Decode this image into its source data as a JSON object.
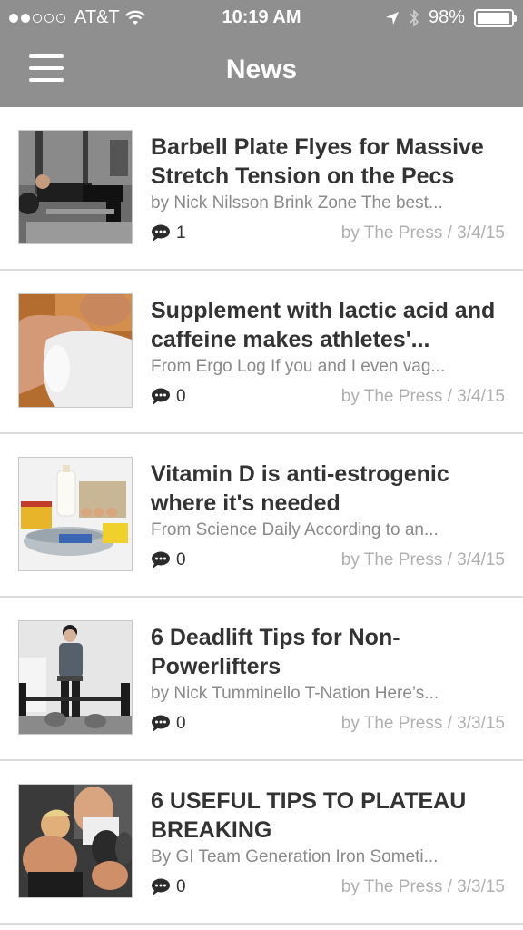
{
  "status_bar": {
    "carrier": "AT&T",
    "time": "10:19 AM",
    "battery": "98%",
    "battery_level": 0.98,
    "icons": [
      "signal-dots-icon",
      "wifi-icon",
      "location-arrow-icon",
      "bluetooth-icon",
      "battery-icon"
    ]
  },
  "navbar": {
    "title": "News",
    "menu_icon": "hamburger-menu-icon",
    "background": "#8f8f8f"
  },
  "articles": [
    {
      "title": "Barbell Plate Flyes for Massive Stretch Tension on the Pecs",
      "excerpt": "by Nick Nilsson Brink Zone The best...",
      "comments": "1",
      "byline": "by The Press / 3/4/15",
      "thumb": "gym-bench-photo"
    },
    {
      "title": "Supplement with lactic acid and caffeine makes athletes'...",
      "excerpt": "From Ergo Log If you and I even vag...",
      "comments": "0",
      "byline": "by The Press / 3/4/15",
      "thumb": "bicep-flex-photo"
    },
    {
      "title": "Vitamin D is anti-estrogenic where it's needed",
      "excerpt": "From Science Daily According to an...",
      "comments": "0",
      "byline": "by The Press / 3/4/15",
      "thumb": "milk-eggs-fish-photo"
    },
    {
      "title": "6 Deadlift Tips for Non-Powerlifters",
      "excerpt": "by Nick Tumminello T-Nation Here’s...",
      "comments": "0",
      "byline": "by The Press / 3/3/15",
      "thumb": "deadlift-photo"
    },
    {
      "title": "6 USEFUL TIPS TO PLATEAU BREAKING",
      "excerpt": "By GI Team Generation Iron Someti...",
      "comments": "0",
      "byline": "by The Press / 3/3/15",
      "thumb": "dumbbell-curl-photo"
    }
  ]
}
